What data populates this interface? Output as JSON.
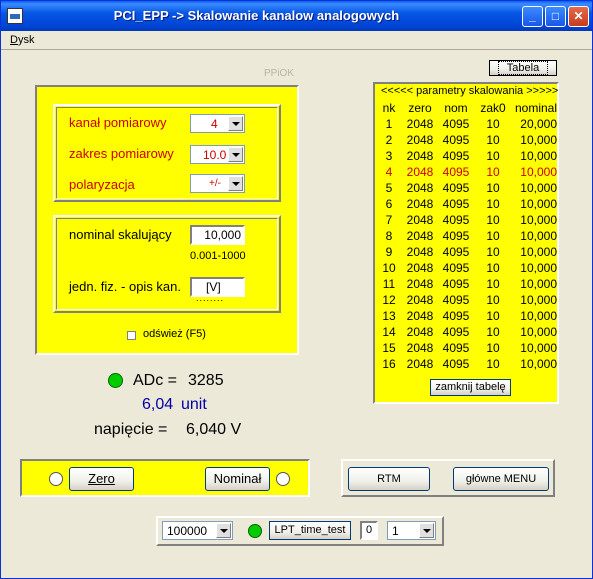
{
  "window": {
    "title": "PCI_EPP -> Skalowanie kanalow analogowych"
  },
  "menu": {
    "items": [
      "Dysk"
    ]
  },
  "tabela_button": "Tabela",
  "ppiok_label": "PPiOK",
  "form": {
    "kanal_label": "kanał pomiarowy",
    "kanal_value": "4",
    "zakres_label": "zakres pomiarowy",
    "zakres_value": "10.0",
    "polaryzacja_label": "polaryzacja",
    "polaryzacja_value": "+/-",
    "nominal_label": "nominal skalujący",
    "nominal_value": "10,000",
    "nominal_range": "0.001-1000",
    "jedn_label": "jedn. fiz. - opis kan.",
    "jedn_value": "[V]",
    "jedn_dots": "........",
    "odswiez_label": "odśwież (F5)"
  },
  "readout": {
    "adc_label": "ADc =",
    "adc_value": "3285",
    "unit_value": "6,04",
    "unit_name": "unit",
    "napiecie_label": "napięcie =",
    "napiecie_value": "6,040 V"
  },
  "buttons": {
    "zero": "Zero",
    "nominal": "Nominał",
    "rtm": "RTM",
    "menu": "główne MENU"
  },
  "bottom": {
    "combo_value": "100000",
    "lpt_button": "LPT_time_test",
    "counter": "0",
    "combo2_value": "1"
  },
  "table": {
    "caption": "<<<<< parametry skalowania >>>>>",
    "headers": [
      "nk",
      "zero",
      "nom",
      "zak0",
      "nominal"
    ],
    "rows": [
      [
        "1",
        "2048",
        "4095",
        "10",
        "20,000"
      ],
      [
        "2",
        "2048",
        "4095",
        "10",
        "10,000"
      ],
      [
        "3",
        "2048",
        "4095",
        "10",
        "10,000"
      ],
      [
        "4",
        "2048",
        "4095",
        "10",
        "10,000"
      ],
      [
        "5",
        "2048",
        "4095",
        "10",
        "10,000"
      ],
      [
        "6",
        "2048",
        "4095",
        "10",
        "10,000"
      ],
      [
        "7",
        "2048",
        "4095",
        "10",
        "10,000"
      ],
      [
        "8",
        "2048",
        "4095",
        "10",
        "10,000"
      ],
      [
        "9",
        "2048",
        "4095",
        "10",
        "10,000"
      ],
      [
        "10",
        "2048",
        "4095",
        "10",
        "10,000"
      ],
      [
        "11",
        "2048",
        "4095",
        "10",
        "10,000"
      ],
      [
        "12",
        "2048",
        "4095",
        "10",
        "10,000"
      ],
      [
        "13",
        "2048",
        "4095",
        "10",
        "10,000"
      ],
      [
        "14",
        "2048",
        "4095",
        "10",
        "10,000"
      ],
      [
        "15",
        "2048",
        "4095",
        "10",
        "10,000"
      ],
      [
        "16",
        "2048",
        "4095",
        "10",
        "10,000"
      ]
    ],
    "highlight_row": 3,
    "close_button": "zamknij tabelę"
  },
  "colors": {
    "panel": "#FFFF00",
    "red": "#CC0000",
    "green": "#00CC00",
    "blue": "#0000AA"
  }
}
